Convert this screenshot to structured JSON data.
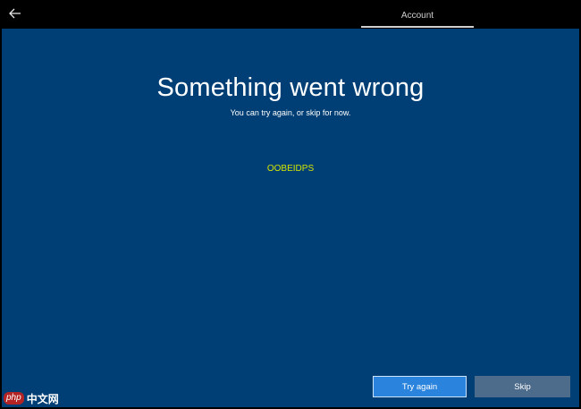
{
  "header": {
    "back_icon": "back-arrow-icon",
    "tab_label": "Account"
  },
  "main": {
    "title": "Something went wrong",
    "subtitle": "You can try again, or skip for now.",
    "error_code": "OOBEIDPS"
  },
  "actions": {
    "try_again_label": "Try again",
    "skip_label": "Skip"
  },
  "watermark": {
    "badge": "php",
    "text": "中文网"
  },
  "colors": {
    "background": "#003f75",
    "topbar": "#000000",
    "error_code": "#d3e600",
    "primary_button": "#2a83dc",
    "secondary_button": "#4d6c8c"
  }
}
